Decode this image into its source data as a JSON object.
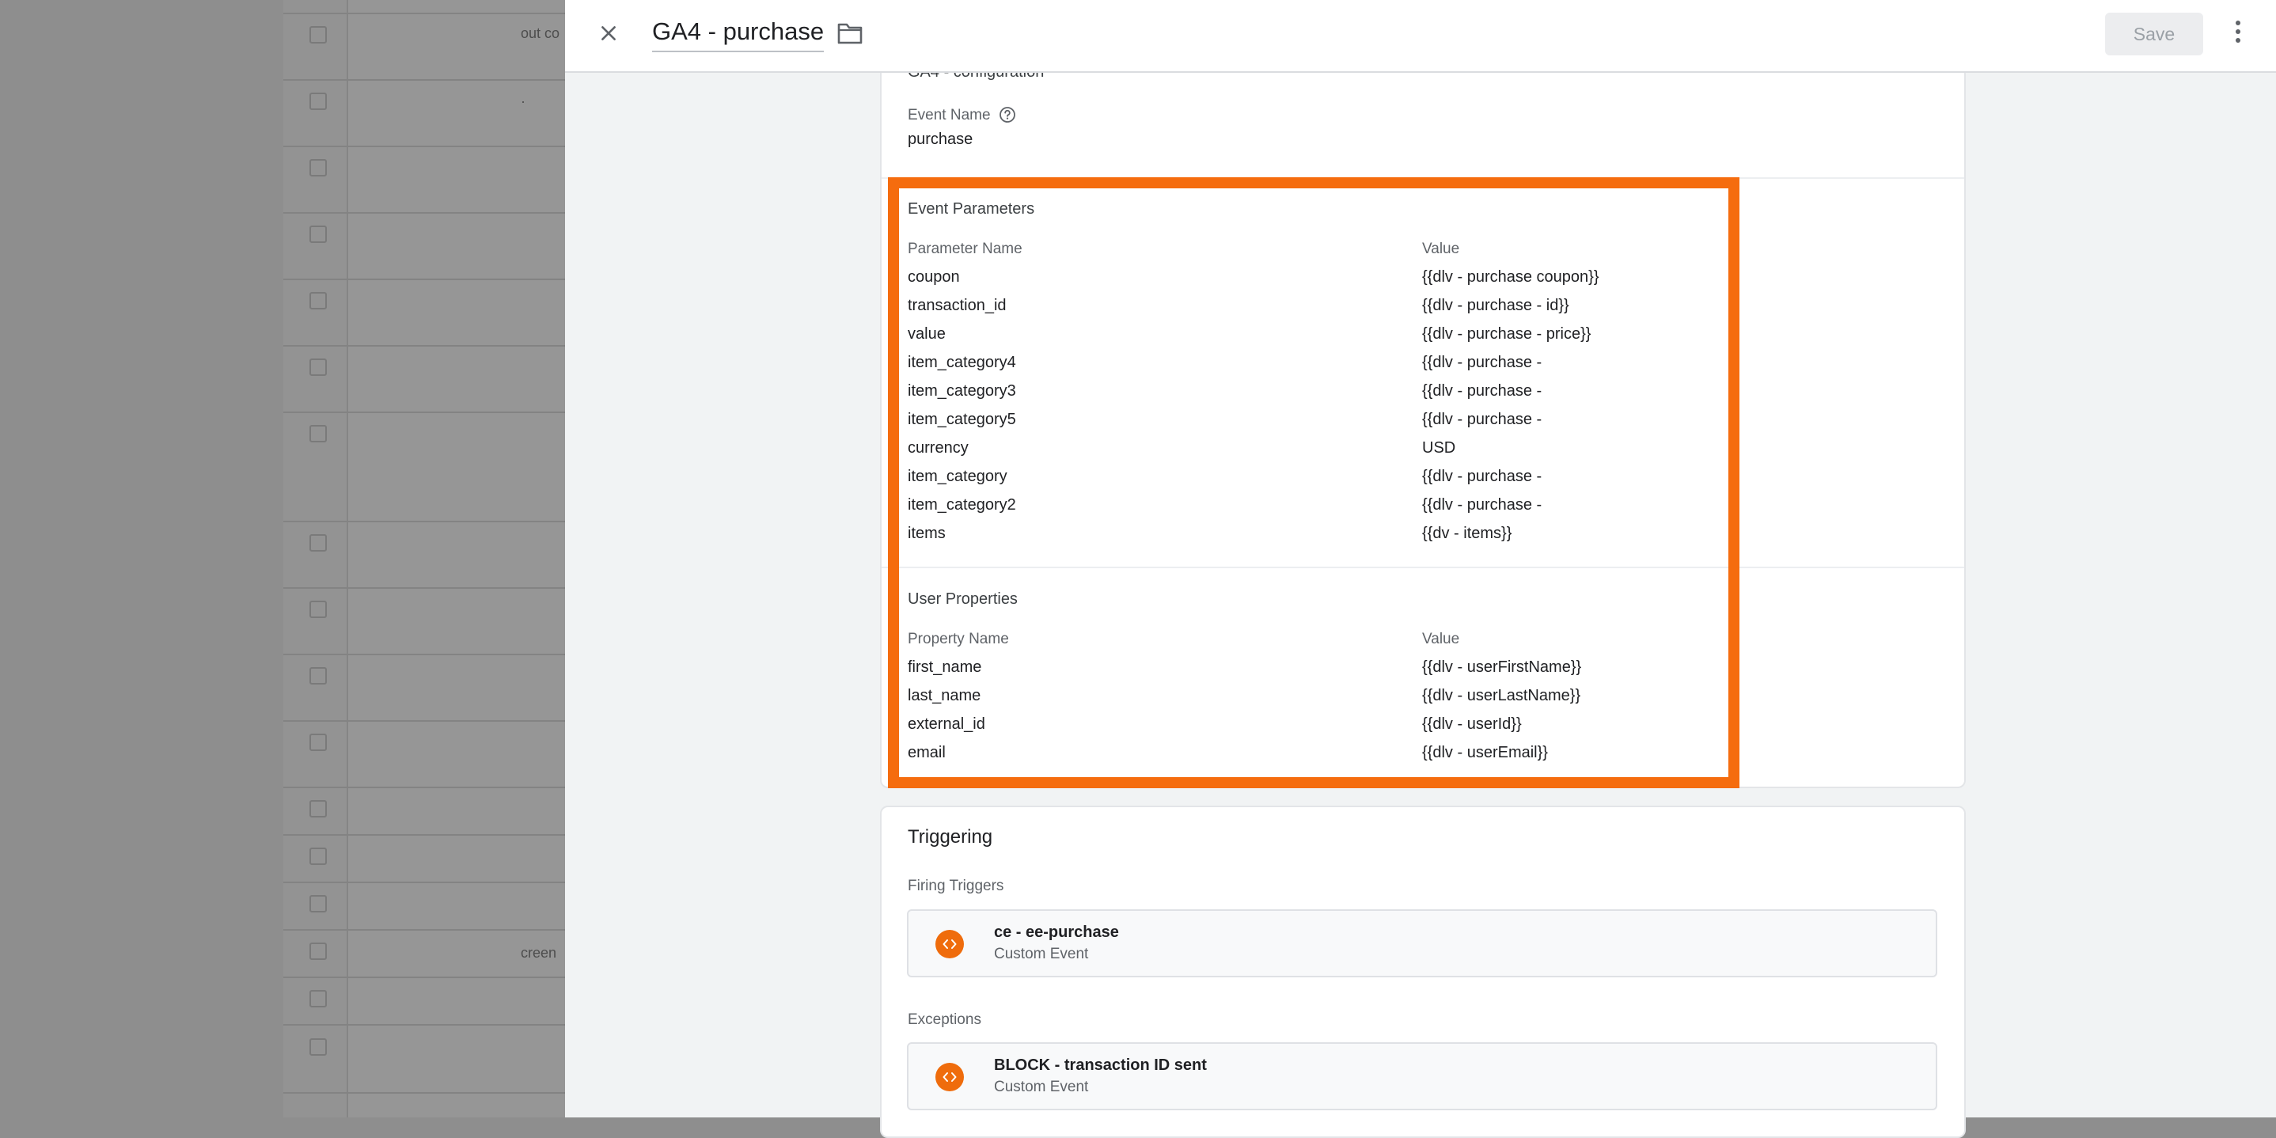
{
  "background": {
    "row_texts": [
      "out co",
      "",
      "creen"
    ]
  },
  "header": {
    "tag_title": "GA4 - purchase",
    "save_label": "Save",
    "close_icon": "close-icon",
    "folder_icon": "folder-icon",
    "more_icon": "more-vert-icon"
  },
  "config": {
    "config_tag_value": "GA4 - configuration",
    "event_name_label": "Event Name",
    "event_name_value": "purchase"
  },
  "event_parameters": {
    "title": "Event Parameters",
    "col_name": "Parameter Name",
    "col_value": "Value",
    "rows": [
      {
        "name": "coupon",
        "value": "{{dlv - purchase coupon}}"
      },
      {
        "name": "transaction_id",
        "value": "{{dlv - purchase - id}}"
      },
      {
        "name": "value",
        "value": "{{dlv - purchase - price}}"
      },
      {
        "name": "item_category4",
        "value": "{{dlv - purchase -"
      },
      {
        "name": "item_category3",
        "value": "{{dlv - purchase -"
      },
      {
        "name": "item_category5",
        "value": "{{dlv - purchase -"
      },
      {
        "name": "currency",
        "value": "USD"
      },
      {
        "name": "item_category",
        "value": "{{dlv - purchase -"
      },
      {
        "name": "item_category2",
        "value": "{{dlv - purchase -"
      },
      {
        "name": "items",
        "value": "{{dv - items}}"
      }
    ]
  },
  "user_properties": {
    "title": "User Properties",
    "col_name": "Property Name",
    "col_value": "Value",
    "rows": [
      {
        "name": "first_name",
        "value": "{{dlv - userFirstName}}"
      },
      {
        "name": "last_name",
        "value": "{{dlv - userLastName}}"
      },
      {
        "name": "external_id",
        "value": "{{dlv - userId}}"
      },
      {
        "name": "email",
        "value": "{{dlv - userEmail}}"
      }
    ]
  },
  "triggering": {
    "title": "Triggering",
    "firing_label": "Firing Triggers",
    "firing": [
      {
        "name": "ce - ee-purchase",
        "type": "Custom Event"
      }
    ],
    "exceptions_label": "Exceptions",
    "exceptions": [
      {
        "name": "BLOCK - transaction ID sent",
        "type": "Custom Event"
      }
    ]
  },
  "colors": {
    "highlight": "#f56c0e",
    "trigger_icon": "#ef6c0c"
  }
}
